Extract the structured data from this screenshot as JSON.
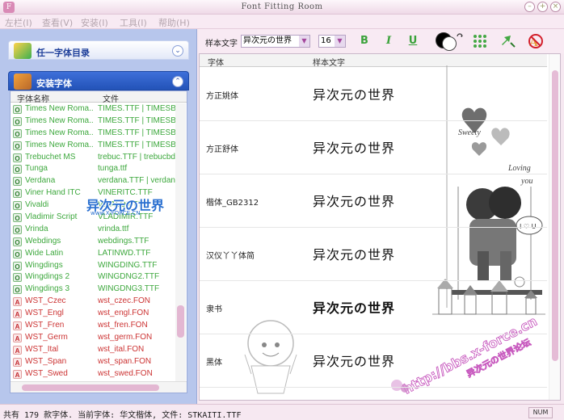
{
  "window": {
    "title": "Font Fitting Room"
  },
  "menu": [
    "左栏(I)",
    "查看(V)",
    "安装(I)",
    "工具(I)",
    "帮助(H)"
  ],
  "sidebar": {
    "category1": "任一字体目录",
    "category2": "安装字体",
    "columns": [
      "字体名称",
      "文件"
    ],
    "fonts": [
      {
        "name": "Times New Roma...",
        "file": "TIMES.TTF | TIMESB",
        "type": "otf"
      },
      {
        "name": "Times New Roma...",
        "file": "TIMES.TTF | TIMESB",
        "type": "otf"
      },
      {
        "name": "Times New Roma...",
        "file": "TIMES.TTF | TIMESB",
        "type": "otf"
      },
      {
        "name": "Times New Roma...",
        "file": "TIMES.TTF | TIMESB",
        "type": "otf"
      },
      {
        "name": "Trebuchet MS",
        "file": "trebuc.TTF | trebucbd",
        "type": "otf"
      },
      {
        "name": "Tunga",
        "file": "tunga.ttf",
        "type": "otf"
      },
      {
        "name": "Verdana",
        "file": "verdana.TTF | verdanab",
        "type": "otf"
      },
      {
        "name": "Viner Hand ITC",
        "file": "VINERITC.TTF",
        "type": "otf"
      },
      {
        "name": "Vivaldi",
        "file": "VIVALDII.TTF",
        "type": "otf"
      },
      {
        "name": "Vladimir Script",
        "file": "VLADIMIR.TTF",
        "type": "otf"
      },
      {
        "name": "Vrinda",
        "file": "vrinda.ttf",
        "type": "otf"
      },
      {
        "name": "Webdings",
        "file": "webdings.TTF",
        "type": "otf"
      },
      {
        "name": "Wide Latin",
        "file": "LATINWD.TTF",
        "type": "otf"
      },
      {
        "name": "Wingdings",
        "file": "WINGDING.TTF",
        "type": "otf"
      },
      {
        "name": "Wingdings 2",
        "file": "WINGDNG2.TTF",
        "type": "otf"
      },
      {
        "name": "Wingdings 3",
        "file": "WINGDNG3.TTF",
        "type": "otf"
      },
      {
        "name": "WST_Czec",
        "file": "wst_czec.FON",
        "type": "fon"
      },
      {
        "name": "WST_Engl",
        "file": "wst_engl.FON",
        "type": "fon"
      },
      {
        "name": "WST_Fren",
        "file": "wst_fren.FON",
        "type": "fon"
      },
      {
        "name": "WST_Germ",
        "file": "wst_germ.FON",
        "type": "fon"
      },
      {
        "name": "WST_Ital",
        "file": "wst_ital.FON",
        "type": "fon"
      },
      {
        "name": "WST_Span",
        "file": "wst_span.FON",
        "type": "fon"
      },
      {
        "name": "WST_Swed",
        "file": "wst_swed.FON",
        "type": "fon"
      }
    ],
    "watermark": "异次元の世界",
    "watermark_sub": "www.X-FORCE.CN"
  },
  "toolbar": {
    "sample_label": "样本文字",
    "sample_value": "异次元の世界",
    "size_value": "16",
    "bold": "B",
    "italic": "I",
    "underline": "U"
  },
  "preview": {
    "columns": [
      "字体",
      "样本文字"
    ],
    "rows": [
      {
        "font": "方正姚体",
        "sample": "异次元の世界"
      },
      {
        "font": "方正舒体",
        "sample": "异次元の世界"
      },
      {
        "font": "楷体_GB2312",
        "sample": "异次元の世界"
      },
      {
        "font": "汉仪丫丫体简",
        "sample": "异次元の世界"
      },
      {
        "font": "隶书",
        "sample": "异次元の世界"
      },
      {
        "font": "黑体",
        "sample": "异次元の世界"
      }
    ],
    "deco_sweety": "Sweety",
    "deco_loving": "Loving",
    "deco_you": "you",
    "deco_ilu": "I ♡ U",
    "deco_url": "http://bbs.x-force.cn",
    "deco_cn": "异次元の世界论坛"
  },
  "status": {
    "text": "共有 179 款字体.  当前字体: 华文楷体, 文件: STKAITI.TTF",
    "num": "NUM"
  },
  "colors": {
    "accent": "#e3b7d2",
    "ttf_green": "#3da83d",
    "fon_red": "#cc3333",
    "sidebar_bg": "#b7c6ec"
  }
}
